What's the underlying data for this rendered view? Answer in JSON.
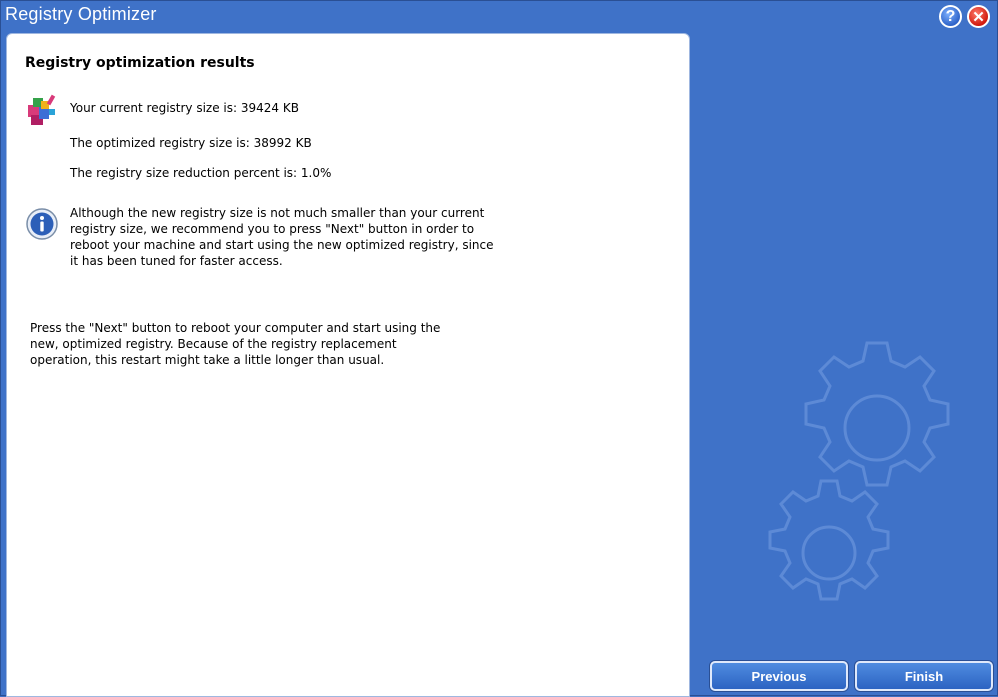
{
  "window": {
    "title": "Registry Optimizer",
    "help_icon_glyph": "?",
    "close_icon_glyph": "✕"
  },
  "content": {
    "heading": "Registry optimization results",
    "current_size": "Your current registry size is: 39424 KB",
    "optimized_size": "The optimized registry size is: 38992 KB",
    "reduction": "The registry size reduction percent is: 1.0%",
    "info_text": "Although the new registry size is not much smaller than your current\nregistry size, we recommend you to press \"Next\" button in order to\nreboot your machine and start using the new optimized registry, since\nit has been tuned for faster access.",
    "instruction_text": "Press the \"Next\" button  to reboot your computer and start using the\nnew, optimized registry. Because of the registry replacement\noperation, this restart might take a little longer than usual."
  },
  "buttons": {
    "previous": "Previous",
    "finish": "Finish"
  },
  "icons": {
    "registry": "registry-cubes-icon",
    "info": "info-icon",
    "gears": "gears-decoration-icon"
  },
  "colors": {
    "background": "#3f72c8",
    "panel": "#ffffff",
    "button": "#2c63c2"
  }
}
